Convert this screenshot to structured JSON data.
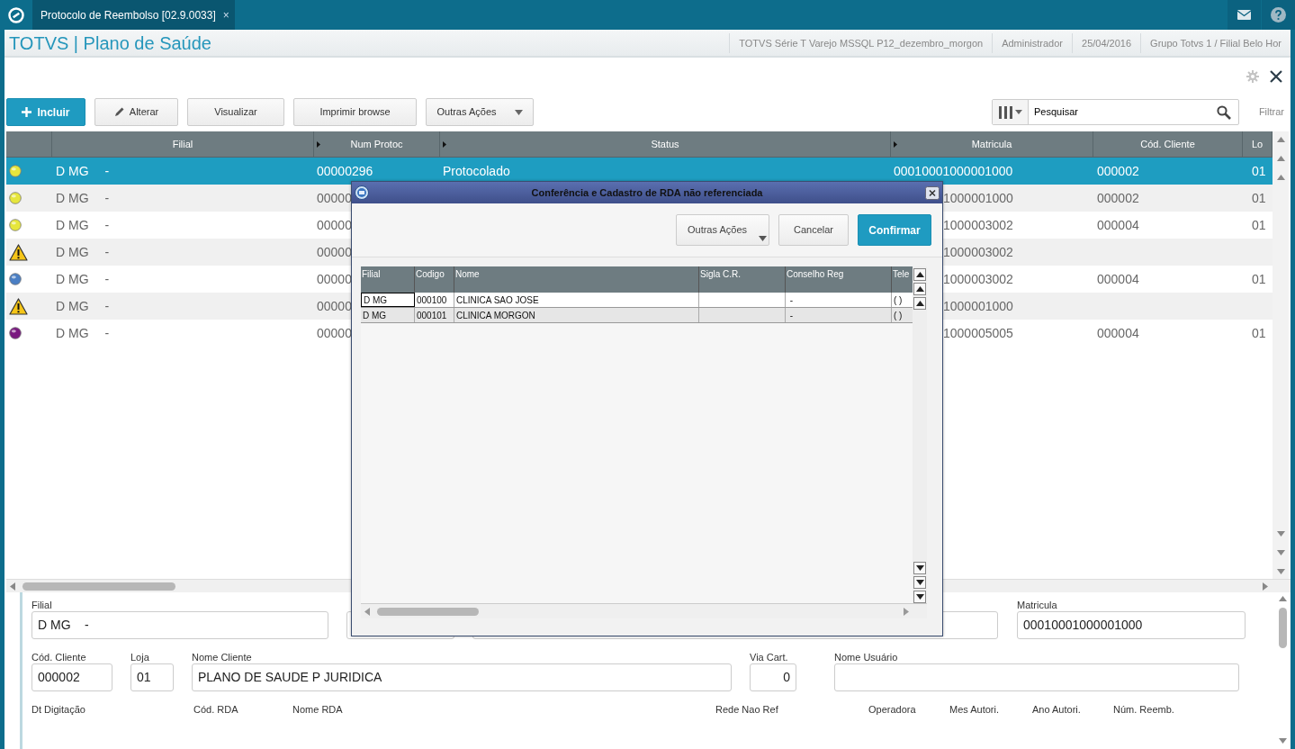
{
  "window": {
    "tab": {
      "title": "Protocolo de Reembolso [02.9.0033]",
      "close": "×"
    }
  },
  "header": {
    "app_title": "TOTVS | Plano de Saúde",
    "info": [
      "TOTVS Série T Varejo MSSQL P12_dezembro_morgon",
      "Administrador",
      "25/04/2016",
      "Grupo Totvs 1 / Filial Belo Hor"
    ]
  },
  "toolbar": {
    "buttons": [
      {
        "label": "Incluir",
        "kind": "primary"
      },
      {
        "label": "Alterar",
        "kind": "edit"
      },
      {
        "label": "Visualizar",
        "kind": "plain"
      },
      {
        "label": "Imprimir browse",
        "kind": "plain"
      },
      {
        "label": "Outras Ações",
        "kind": "dropdown"
      }
    ],
    "search": {
      "value": "Pesquisar"
    },
    "filter": "Filtrar"
  },
  "grid": {
    "columns": [
      {
        "label": "Filial"
      },
      {
        "label": "Num Protoc",
        "sort_marker": true
      },
      {
        "label": "Status",
        "sort_marker": true
      },
      {
        "label": "Matricula",
        "sort_marker": true
      },
      {
        "label": "Cód. Cliente"
      },
      {
        "label": "Lo"
      }
    ],
    "rows": [
      {
        "selected": true,
        "covered": false,
        "status": {
          "kind": "dot",
          "color": "#e6e63c"
        },
        "filial": "D MG",
        "filial_name": "-",
        "num_protoc": "00000296",
        "status_text": "Protocolado",
        "matricula": "00010001000001000",
        "cod_cliente": "000002",
        "loja": "01"
      },
      {
        "selected": false,
        "covered": true,
        "status": {
          "kind": "dot",
          "color": "#e6e63c"
        },
        "filial": "D MG",
        "filial_name": "-",
        "num_protoc": "00000",
        "matricula": "1000001000",
        "cod_cliente": "000002",
        "loja": "01"
      },
      {
        "selected": false,
        "covered": true,
        "status": {
          "kind": "dot",
          "color": "#e6e63c"
        },
        "filial": "D MG",
        "filial_name": "-",
        "num_protoc": "00000",
        "matricula": "1000003002",
        "cod_cliente": "000004",
        "loja": "01"
      },
      {
        "selected": false,
        "covered": true,
        "status": {
          "kind": "warning"
        },
        "filial": "D MG",
        "filial_name": "-",
        "num_protoc": "00000",
        "matricula": "1000003002"
      },
      {
        "selected": false,
        "covered": true,
        "status": {
          "kind": "dot",
          "color": "#4a7fc4"
        },
        "filial": "D MG",
        "filial_name": "-",
        "num_protoc": "00000",
        "matricula": "1000003002",
        "cod_cliente": "000004",
        "loja": "01"
      },
      {
        "selected": false,
        "covered": true,
        "status": {
          "kind": "warning"
        },
        "filial": "D MG",
        "filial_name": "-",
        "num_protoc": "00000",
        "matricula": "1000001000"
      },
      {
        "selected": false,
        "covered": true,
        "status": {
          "kind": "dot",
          "color": "#7a1a80"
        },
        "filial": "D MG",
        "filial_name": "-",
        "num_protoc": "00000",
        "matricula": "1000005005",
        "cod_cliente": "000004",
        "loja": "01"
      }
    ]
  },
  "form": {
    "groups": [
      {
        "fields": [
          {
            "kind": "text",
            "label": "Filial",
            "value": "D MG    -"
          },
          {
            "kind": "text"
          },
          {
            "kind": "text"
          },
          {
            "kind": "text",
            "label": "Matricula",
            "value": "00010001000001000"
          }
        ]
      },
      {
        "fields": [
          {
            "kind": "text",
            "label": "Cód. Cliente",
            "value": "000002"
          },
          {
            "kind": "text",
            "label": "Loja",
            "value": "01"
          },
          {
            "kind": "text",
            "label": "Nome Cliente",
            "value": "PLANO DE SAUDE P JURIDICA"
          },
          {
            "kind": "number",
            "label": "Via Cart.",
            "value": "0"
          },
          {
            "kind": "text",
            "label": "Nome Usuário"
          }
        ]
      },
      {
        "fields": [
          {
            "kind": "cut",
            "label": "Dt Digitação"
          },
          {
            "kind": "cut",
            "label": "Cód. RDA"
          },
          {
            "kind": "cut",
            "label": "Nome RDA"
          },
          {
            "kind": "cut",
            "label": "Rede Nao Ref"
          },
          {
            "kind": "cut",
            "label": "Operadora"
          },
          {
            "kind": "cut",
            "label": "Mes Autori."
          },
          {
            "kind": "cut",
            "label": "Ano Autori."
          },
          {
            "kind": "cut",
            "label": "Núm. Reemb."
          }
        ]
      }
    ]
  },
  "dialog": {
    "title": "Conferência e Cadastro de RDA não referenciada",
    "buttons": [
      {
        "label": "Outras Ações",
        "kind": "dropdown"
      },
      {
        "label": "Cancelar",
        "kind": "plain"
      },
      {
        "label": "Confirmar",
        "kind": "primary"
      }
    ],
    "columns": [
      "Filial",
      "Codigo",
      "Nome",
      "Sigla C.R.",
      "Conselho Reg",
      "Tele"
    ],
    "rows": [
      {
        "focused": true,
        "cells": [
          "D MG",
          "000100",
          "CLINICA SAO JOSE",
          null,
          " -",
          "( )"
        ]
      },
      {
        "focused": false,
        "cells": [
          "D MG",
          "000101",
          "CLINICA MORGON",
          null,
          " -",
          "( )"
        ]
      }
    ]
  }
}
